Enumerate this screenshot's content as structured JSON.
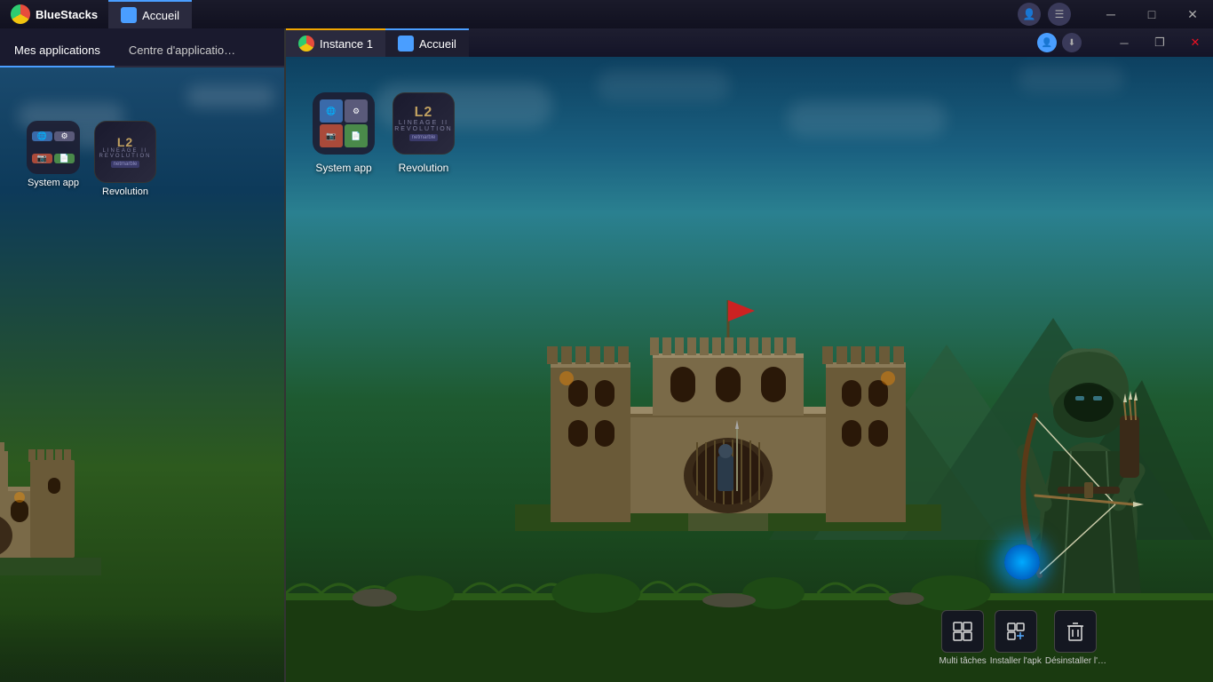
{
  "outer": {
    "logo_text": "BlueStacks",
    "tab_label": "Accueil",
    "window_controls": {
      "minimize": "─",
      "maximize": "□",
      "close": "✕"
    }
  },
  "inner": {
    "instance_tab_label": "Instance 1",
    "accueil_tab_label": "Accueil",
    "window_controls": {
      "minimize": "─",
      "maximize": "❐",
      "close": "✕"
    }
  },
  "left_panel": {
    "nav_tabs": [
      {
        "label": "Mes applications",
        "active": true
      },
      {
        "label": "Centre d'applicatio…",
        "active": false
      }
    ],
    "apps": [
      {
        "label": "System app",
        "type": "system"
      },
      {
        "label": "Revolution",
        "type": "lineage"
      }
    ]
  },
  "inner_panel": {
    "apps": [
      {
        "label": "System app",
        "type": "system"
      },
      {
        "label": "Revolution",
        "type": "lineage"
      }
    ]
  },
  "toolbar": {
    "buttons": [
      {
        "label": "Multi tâches",
        "icon": "⊞"
      },
      {
        "label": "Installer l'apk",
        "icon": "⊕"
      },
      {
        "label": "Désinstaller l'…",
        "icon": "🗑"
      }
    ]
  }
}
